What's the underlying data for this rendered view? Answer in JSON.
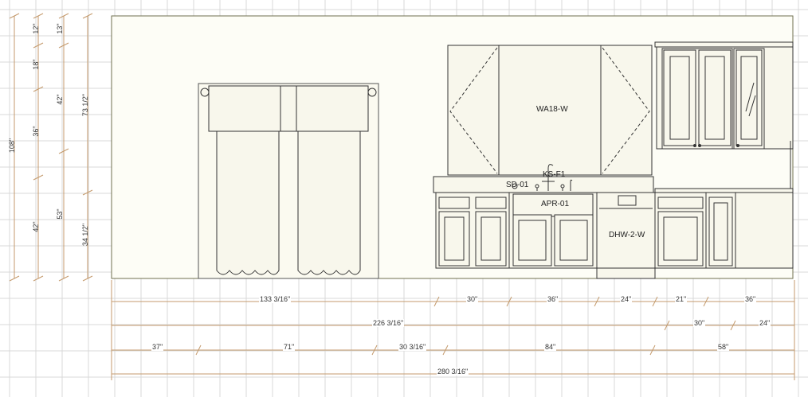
{
  "labels": {
    "wall_cabinet": "WA18-W",
    "faucet": "KS-F1",
    "sink": "SD-01",
    "apron": "APR-01",
    "dishwasher": "DHW-2-W"
  },
  "dims_horizontal": {
    "row1": [
      "133 3/16\"",
      "30\"",
      "36\"",
      "24\"",
      "21\"",
      "36\""
    ],
    "row2": [
      "226 3/16\"",
      "30\"",
      "24\""
    ],
    "row3": [
      "37\"",
      "71\"",
      "30 3/16\"",
      "84\"",
      "58\""
    ],
    "row4": [
      "280 3/16\""
    ]
  },
  "dims_vertical": {
    "col1": [
      "108\""
    ],
    "col2": [
      "12\"",
      "18\"",
      "36\"",
      "42\""
    ],
    "col3": [
      "13\"",
      "42\"",
      "53\""
    ],
    "col4": [
      "73 1/2\"",
      "34 1/2\""
    ]
  },
  "colors": {
    "grid": "#d8d8d8",
    "outline": "#7a7a5a",
    "fill": "#fafaf2",
    "dimension": "#c49a6c",
    "stroke": "#333333"
  }
}
